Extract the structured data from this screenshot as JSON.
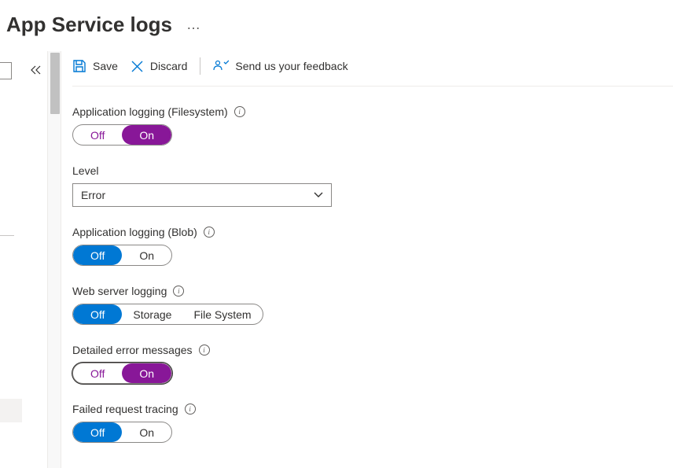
{
  "header": {
    "title": "App Service logs",
    "more": "…"
  },
  "toolbar": {
    "save": "Save",
    "discard": "Discard",
    "feedback": "Send us your feedback"
  },
  "sections": {
    "appLoggingFs": {
      "label": "Application logging (Filesystem)",
      "off": "Off",
      "on": "On"
    },
    "level": {
      "label": "Level",
      "value": "Error"
    },
    "appLoggingBlob": {
      "label": "Application logging (Blob)",
      "off": "Off",
      "on": "On"
    },
    "webServer": {
      "label": "Web server logging",
      "off": "Off",
      "storage": "Storage",
      "fs": "File System"
    },
    "detailedErrors": {
      "label": "Detailed error messages",
      "off": "Off",
      "on": "On"
    },
    "failedRequest": {
      "label": "Failed request tracing",
      "off": "Off",
      "on": "On"
    }
  },
  "colors": {
    "blue": "#0078d4",
    "purple": "#881798"
  }
}
